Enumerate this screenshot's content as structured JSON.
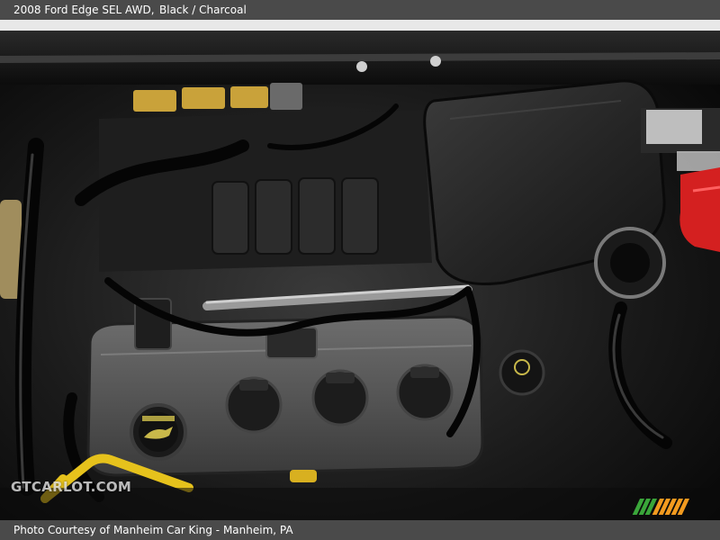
{
  "header": {
    "model": "2008 Ford Edge SEL AWD,",
    "colors": "Black / Charcoal"
  },
  "watermark": {
    "text": "GTCARLOT.COM"
  },
  "footer": {
    "credit": "Photo Courtesy of Manheim Car King - Manheim, PA"
  },
  "colors": {
    "bar": "#4a4a4a",
    "stripe_green": "#3aa63a",
    "stripe_orange": "#f29a1f",
    "battery_red": "#d42020"
  },
  "icons": [
    "oil-cap-icon",
    "brand-stripes-icon"
  ]
}
